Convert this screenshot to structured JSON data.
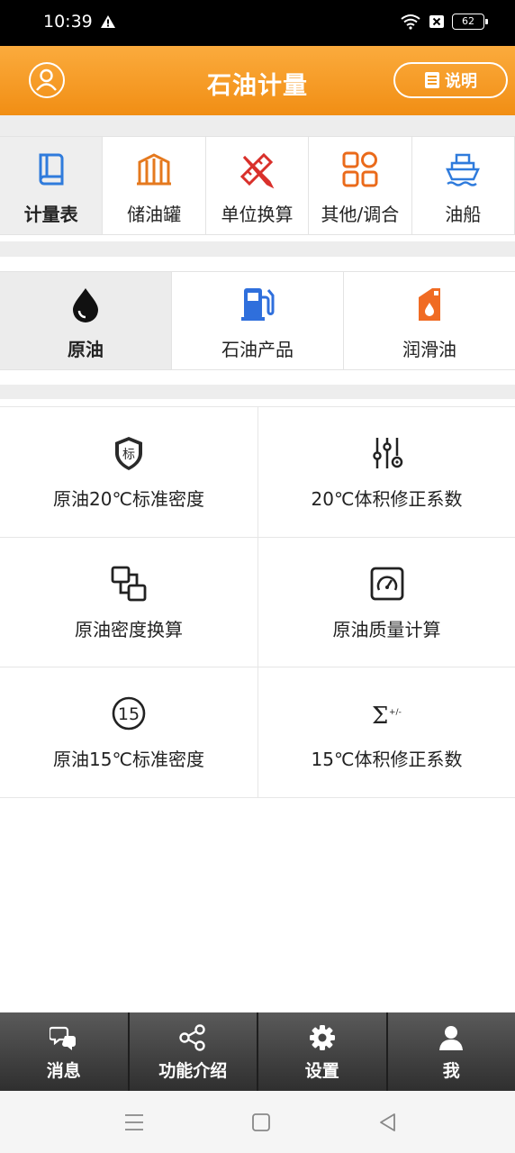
{
  "status": {
    "time": "10:39",
    "battery": "62"
  },
  "header": {
    "title": "石油计量",
    "help_label": "说明",
    "accent": "#f39a22"
  },
  "categories": [
    {
      "label": "计量表",
      "icon": "book-icon",
      "color": "#2f7bdc",
      "active": true
    },
    {
      "label": "储油罐",
      "icon": "tank-icon",
      "color": "#e5791e"
    },
    {
      "label": "单位换算",
      "icon": "ruler-pencil-icon",
      "color": "#d9302b"
    },
    {
      "label": "其他/调合",
      "icon": "grid-icon",
      "color": "#ea6a1a"
    },
    {
      "label": "油船",
      "icon": "ship-icon",
      "color": "#2f7bdc"
    }
  ],
  "subtabs": [
    {
      "label": "原油",
      "icon": "oil-drop-icon",
      "active": true
    },
    {
      "label": "石油产品",
      "icon": "fuel-pump-icon",
      "color": "#2f6fdc"
    },
    {
      "label": "润滑油",
      "icon": "oil-can-icon",
      "color": "#f06b23"
    }
  ],
  "functions": [
    {
      "label": "原油20℃标准密度",
      "icon": "shield-standard-icon",
      "glyph": "标"
    },
    {
      "label": "20℃体积修正系数",
      "icon": "sliders-icon"
    },
    {
      "label": "原油密度换算",
      "icon": "convert-squares-icon"
    },
    {
      "label": "原油质量计算",
      "icon": "gauge-icon"
    },
    {
      "label": "原油15℃标准密度",
      "icon": "circle-15-icon",
      "glyph": "15"
    },
    {
      "label": "15℃体积修正系数",
      "icon": "sigma-icon",
      "glyph": "Σ",
      "glyph_small": "+/-"
    }
  ],
  "bottom_nav": [
    {
      "label": "消息",
      "icon": "chat-icon"
    },
    {
      "label": "功能介绍",
      "icon": "share-icon"
    },
    {
      "label": "设置",
      "icon": "gear-icon"
    },
    {
      "label": "我",
      "icon": "user-icon"
    }
  ]
}
